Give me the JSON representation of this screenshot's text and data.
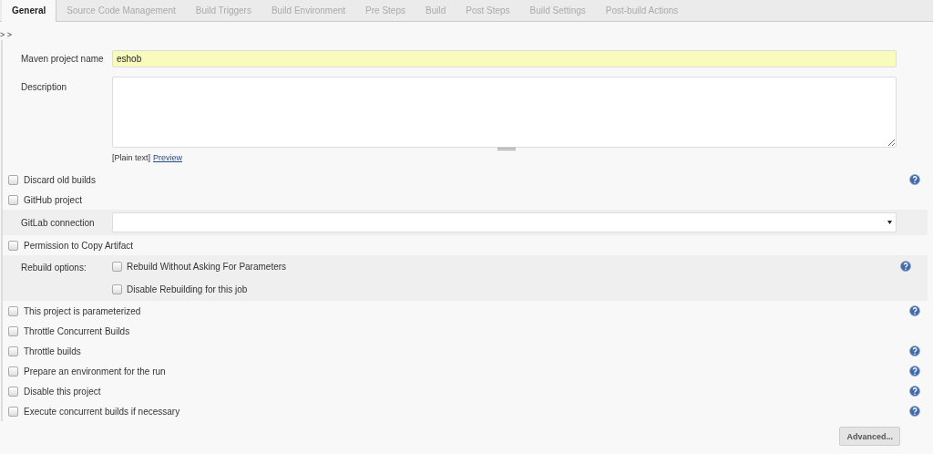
{
  "tabs": [
    {
      "label": "General",
      "selected": true
    },
    {
      "label": "Source Code Management",
      "selected": false
    },
    {
      "label": "Build Triggers",
      "selected": false
    },
    {
      "label": "Build Environment",
      "selected": false
    },
    {
      "label": "Pre Steps",
      "selected": false
    },
    {
      "label": "Build",
      "selected": false
    },
    {
      "label": "Post Steps",
      "selected": false
    },
    {
      "label": "Build Settings",
      "selected": false
    },
    {
      "label": "Post-build Actions",
      "selected": false
    }
  ],
  "breadcrumb": "> >",
  "project_name": {
    "label": "Maven project name",
    "value": "eshob"
  },
  "description": {
    "label": "Description",
    "format": "[Plain text]",
    "preview_link": "Preview"
  },
  "options": [
    {
      "kind": "checkbox",
      "label": "Discard old builds",
      "checked": false,
      "help": true
    },
    {
      "kind": "checkbox",
      "label": "GitHub project",
      "checked": false,
      "help": false
    },
    {
      "kind": "select",
      "label": "GitLab connection",
      "help": false
    },
    {
      "kind": "checkbox",
      "label": "Permission to Copy Artifact",
      "checked": false,
      "help": false
    },
    {
      "kind": "group",
      "label": "Rebuild options:",
      "help": true,
      "items": [
        {
          "label": "Rebuild Without Asking For Parameters",
          "checked": false
        },
        {
          "label": "Disable Rebuilding for this job",
          "checked": false
        }
      ]
    },
    {
      "kind": "checkbox",
      "label": "This project is parameterized",
      "checked": false,
      "help": true
    },
    {
      "kind": "checkbox",
      "label": "Throttle Concurrent Builds",
      "checked": false,
      "help": false
    },
    {
      "kind": "checkbox",
      "label": "Throttle builds",
      "checked": false,
      "help": true
    },
    {
      "kind": "checkbox",
      "label": "Prepare an environment for the run",
      "checked": false,
      "help": true
    },
    {
      "kind": "checkbox",
      "label": "Disable this project",
      "checked": false,
      "help": true
    },
    {
      "kind": "checkbox",
      "label": "Execute concurrent builds if necessary",
      "checked": false,
      "help": true
    }
  ],
  "advanced_button": "Advanced..."
}
